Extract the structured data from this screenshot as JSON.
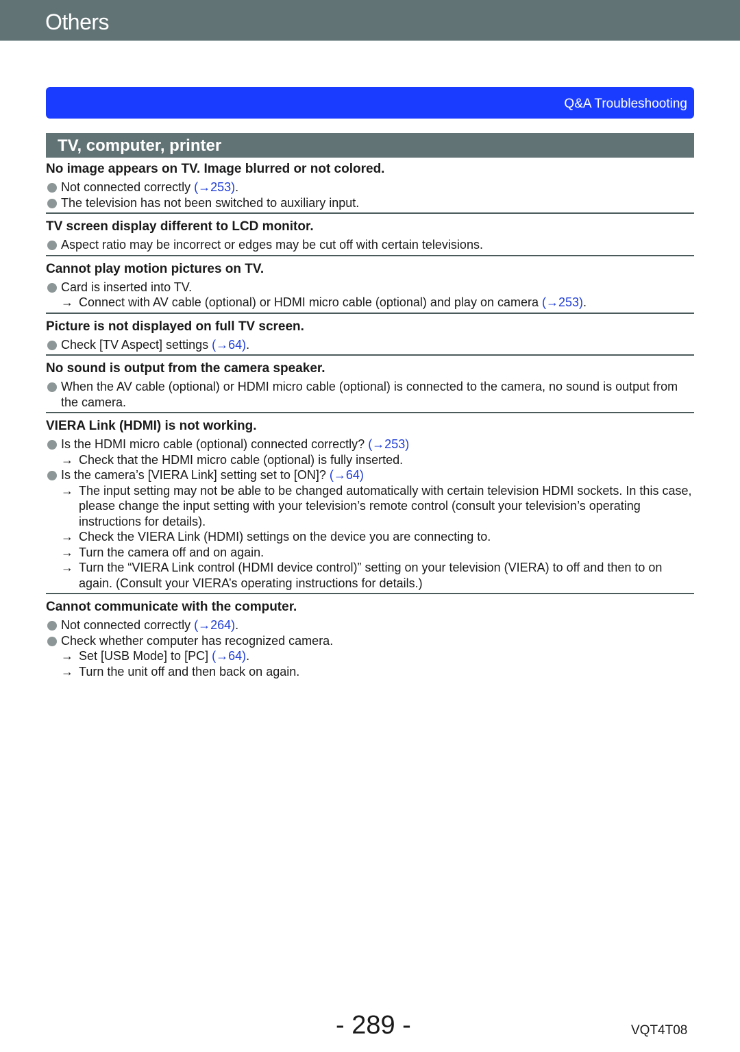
{
  "header": {
    "title": "Others"
  },
  "banner": {
    "label": "Q&A  Troubleshooting"
  },
  "section": {
    "title": "TV, computer, printer"
  },
  "colors": {
    "header_bg": "#627375",
    "banner_bg": "#1a3cff",
    "link": "#1f3dd6",
    "bullet": "#8d9696"
  },
  "qa": [
    {
      "question": "No image appears on TV. Image blurred or not colored.",
      "lines": [
        {
          "type": "bullet",
          "text": "Not connected correctly ",
          "link": "(→253)",
          "after": "."
        },
        {
          "type": "bullet",
          "text": "The television has not been switched to auxiliary input.",
          "link": "",
          "after": ""
        }
      ]
    },
    {
      "question": "TV screen display different to LCD monitor.",
      "lines": [
        {
          "type": "bullet",
          "text": "Aspect ratio may be incorrect or edges may be cut off with certain televisions.",
          "link": "",
          "after": ""
        }
      ]
    },
    {
      "question": "Cannot play motion pictures on TV.",
      "lines": [
        {
          "type": "bullet",
          "text": "Card is inserted into TV.",
          "link": "",
          "after": ""
        },
        {
          "type": "arrow",
          "text": "Connect with AV cable (optional) or HDMI micro cable (optional) and play on camera ",
          "link": "(→253)",
          "after": "."
        }
      ]
    },
    {
      "question": "Picture is not displayed on full TV screen.",
      "lines": [
        {
          "type": "bullet",
          "text": "Check [TV Aspect] settings ",
          "link": "(→64)",
          "after": "."
        }
      ]
    },
    {
      "question": "No sound is output from the camera speaker.",
      "lines": [
        {
          "type": "bullet",
          "text": "When the AV cable (optional) or HDMI micro cable (optional) is connected to the camera, no sound is output from the camera.",
          "link": "",
          "after": ""
        }
      ]
    },
    {
      "question": "VIERA Link (HDMI) is not working.",
      "lines": [
        {
          "type": "bullet",
          "text": "Is the HDMI micro cable (optional) connected correctly? ",
          "link": "(→253)",
          "after": ""
        },
        {
          "type": "arrow",
          "text": "Check that the HDMI micro cable (optional) is fully inserted.",
          "link": "",
          "after": ""
        },
        {
          "type": "bullet",
          "text": "Is the camera’s [VIERA Link] setting set to [ON]? ",
          "link": "(→64)",
          "after": ""
        },
        {
          "type": "arrow",
          "text": "The input setting may not be able to be changed automatically with certain television HDMI sockets. In this case, please change the input setting with your television’s remote control (consult your television’s operating instructions for details).",
          "link": "",
          "after": ""
        },
        {
          "type": "arrow",
          "text": "Check the VIERA Link (HDMI) settings on the device you are connecting to.",
          "link": "",
          "after": ""
        },
        {
          "type": "arrow",
          "text": "Turn the camera off and on again.",
          "link": "",
          "after": ""
        },
        {
          "type": "arrow",
          "text": "Turn the “VIERA Link control (HDMI device control)” setting on your television (VIERA) to off and then to on again. (Consult your VIERA’s operating instructions for details.)",
          "link": "",
          "after": ""
        }
      ]
    },
    {
      "question": "Cannot communicate with the computer.",
      "lines": [
        {
          "type": "bullet",
          "text": "Not connected correctly ",
          "link": "(→264)",
          "after": "."
        },
        {
          "type": "bullet",
          "text": "Check whether computer has recognized camera.",
          "link": "",
          "after": ""
        },
        {
          "type": "arrow",
          "text": "Set [USB Mode] to [PC] ",
          "link": "(→64)",
          "after": "."
        },
        {
          "type": "arrow",
          "text": "Turn the unit off and then back on again.",
          "link": "",
          "after": ""
        }
      ]
    }
  ],
  "arrow_glyph": "→",
  "footer": {
    "page": "- 289 -",
    "code": "VQT4T08"
  }
}
